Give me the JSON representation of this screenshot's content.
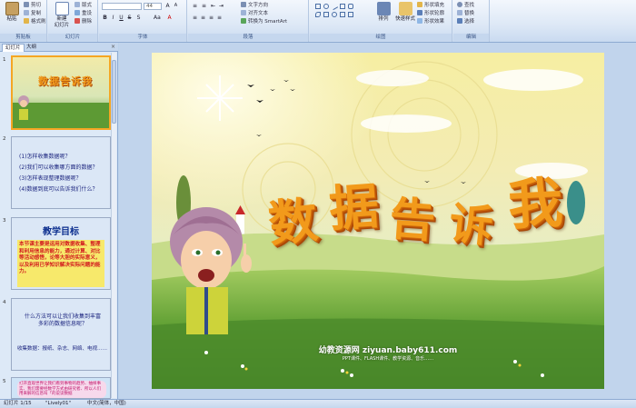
{
  "ribbon": {
    "clipboard": {
      "paste": "粘贴",
      "cut": "剪切",
      "copy": "复制",
      "format_painter": "格式刷",
      "label": "剪贴板"
    },
    "slides": {
      "new_slide": "新建\n幻灯片",
      "layout": "版式",
      "reset": "重设",
      "delete": "删除",
      "label": "幻灯片"
    },
    "font": {
      "size": "44",
      "label": "字体"
    },
    "paragraph": {
      "text_direction": "文字方向",
      "align_text": "对齐文本",
      "smartart": "转换为 SmartArt",
      "label": "段落"
    },
    "drawing": {
      "arrange": "排列",
      "quick_styles": "快速样式",
      "shape_fill": "形状填充",
      "shape_outline": "形状轮廓",
      "shape_effects": "形状效果",
      "label": "绘图"
    },
    "editing": {
      "find": "查找",
      "replace": "替换",
      "select": "选择",
      "label": "编辑"
    }
  },
  "panel": {
    "tab_slides": "幻灯片",
    "tab_outline": "大纲",
    "close": "×",
    "slides": [
      {
        "num": "1",
        "title": "数据告诉我"
      },
      {
        "num": "2",
        "lines": [
          "(1)怎样收集数据呢？",
          "(2)我们可以收集哪方面的数据？",
          "(3)怎样表现整理数据呢？",
          "(4)数据到底可以告诉我们什么？"
        ]
      },
      {
        "num": "3",
        "heading": "教学目标",
        "body": "本节课主要是运用对数据收集、整理和利用信息的能力，通过计算、对比等活动感悟，论等大胆的实际意义，以及利用已学知识解决实际问题的能力。"
      },
      {
        "num": "4",
        "question": "什么方法可以让我们收集到丰富多彩的数据信息呢？",
        "answer": "收集数据：报纸、杂志、网络、电视……"
      },
      {
        "num": "5",
        "text": "打开直观世界让我们看到事物的趋势、抽样事实、我们需要经数学方式由研究者、所以人们用来解的信息叫「的说读数据"
      }
    ]
  },
  "slide": {
    "title_chars": [
      "数",
      "据",
      "告",
      "诉",
      "我"
    ],
    "watermark_main": "幼教资源网 ziyuan.baby611.com",
    "watermark_sub": "PPT课件、FLASH课件、教学资源、音乐……"
  },
  "status": {
    "slide_info": "幻灯片 1/15",
    "theme": "\"Lively01\"",
    "language": "中文(简体，中国)"
  },
  "colors": {
    "accent": "#f5a623",
    "ribbon_bg": "#dde8f6",
    "title_orange": "#f29a1b"
  }
}
